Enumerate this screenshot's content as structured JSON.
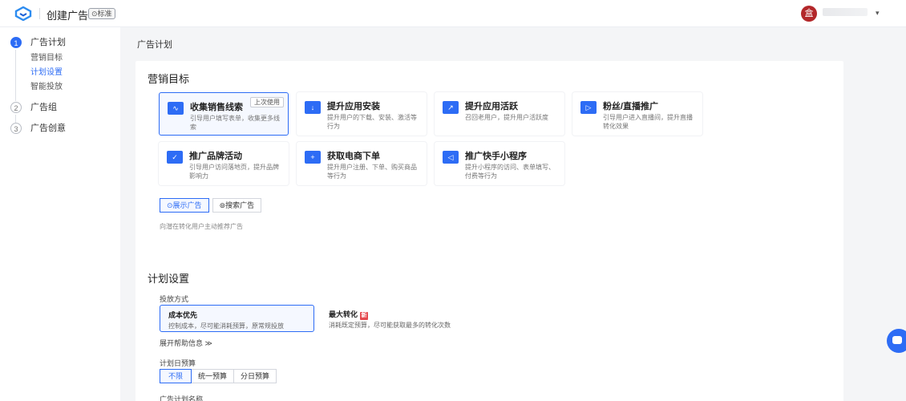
{
  "header": {
    "app_title": "创建广告",
    "edition_badge": "⊙标准",
    "avatar_text": "盒",
    "chevron": "▾"
  },
  "sidebar": {
    "steps": [
      {
        "num": "1",
        "label": "广告计划",
        "active": true
      },
      {
        "num": "2",
        "label": "广告组",
        "active": false
      },
      {
        "num": "3",
        "label": "广告创意",
        "active": false
      }
    ],
    "substeps": [
      "营销目标",
      "计划设置",
      "智能投放"
    ]
  },
  "main": {
    "page_title": "广告计划",
    "marketing": {
      "title": "营销目标",
      "goals": [
        {
          "name": "收集销售线索",
          "desc": "引导用户填写表单，收集更多线索",
          "icon": "∿",
          "tag": "上次使用"
        },
        {
          "name": "提升应用安装",
          "desc": "提升用户的下载、安装、激活等行为",
          "icon": "↓"
        },
        {
          "name": "提升应用活跃",
          "desc": "召回老用户，提升用户活跃度",
          "icon": "↗"
        },
        {
          "name": "粉丝/直播推广",
          "desc": "引导用户进入直播间，提升直播转化效果",
          "icon": "▷"
        },
        {
          "name": "推广品牌活动",
          "desc": "引导用户访问落地页，提升品牌影响力",
          "icon": "✓"
        },
        {
          "name": "获取电商下单",
          "desc": "提升用户注册、下单、购买商品等行为",
          "icon": "+"
        },
        {
          "name": "推广快手小程序",
          "desc": "提升小程序的访问、表单填写、付费等行为",
          "icon": "◁"
        }
      ],
      "ad_types": [
        {
          "label": "展示广告",
          "icon": "⊙"
        },
        {
          "label": "搜索广告",
          "icon": "⊚"
        }
      ],
      "ad_type_hint": "向潜在转化用户主动推荐广告"
    },
    "plan": {
      "title": "计划设置",
      "delivery_label": "投放方式",
      "strategies": [
        {
          "name": "成本优先",
          "desc": "控制成本，尽可能消耗预算，原常规投放"
        },
        {
          "name": "最大转化",
          "desc": "消耗既定预算，尽可能获取最多的转化次数",
          "badge": "新"
        }
      ],
      "expand_help": "展开帮助信息 ≫",
      "budget_label": "计划日预算",
      "budget_options": [
        "不限",
        "统一预算",
        "分日预算"
      ],
      "name_label": "广告计划名称"
    }
  }
}
